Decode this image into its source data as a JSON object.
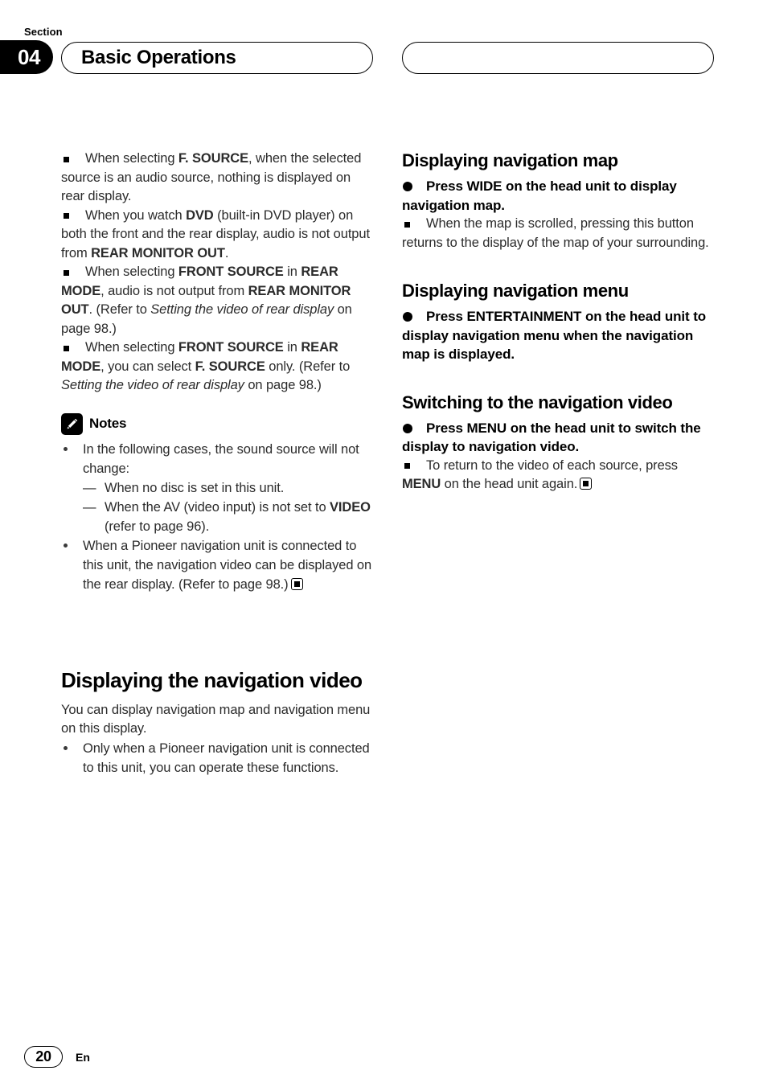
{
  "header": {
    "section_label": "Section",
    "section_number": "04",
    "title": "Basic Operations",
    "right_pill_text": ""
  },
  "left_column": {
    "notes_bullets": [
      {
        "id": "b1",
        "segments": [
          {
            "t": "When selecting ",
            "s": "normal"
          },
          {
            "t": "F. SOURCE",
            "s": "bold"
          },
          {
            "t": ", when the selected source is an audio source, nothing is displayed on rear display.",
            "s": "normal"
          }
        ]
      },
      {
        "id": "b2",
        "segments": [
          {
            "t": "When you watch ",
            "s": "normal"
          },
          {
            "t": "DVD",
            "s": "bold"
          },
          {
            "t": " (built-in DVD player) on both the front and the rear display, audio is not output from ",
            "s": "normal"
          },
          {
            "t": "REAR MONITOR OUT",
            "s": "bold"
          },
          {
            "t": ".",
            "s": "normal"
          }
        ]
      },
      {
        "id": "b3",
        "segments": [
          {
            "t": "When selecting ",
            "s": "normal"
          },
          {
            "t": "FRONT SOURCE",
            "s": "bold"
          },
          {
            "t": " in ",
            "s": "normal"
          },
          {
            "t": "REAR MODE",
            "s": "bold"
          },
          {
            "t": ", audio is not output from ",
            "s": "normal"
          },
          {
            "t": "REAR MONITOR OUT",
            "s": "bold"
          },
          {
            "t": ". (Refer to ",
            "s": "normal"
          },
          {
            "t": "Setting the video of rear display",
            "s": "italic"
          },
          {
            "t": " on page 98.)",
            "s": "normal"
          }
        ]
      },
      {
        "id": "b4",
        "segments": [
          {
            "t": "When selecting ",
            "s": "normal"
          },
          {
            "t": "FRONT SOURCE",
            "s": "bold"
          },
          {
            "t": " in ",
            "s": "normal"
          },
          {
            "t": "REAR MODE",
            "s": "bold"
          },
          {
            "t": ", you can select ",
            "s": "normal"
          },
          {
            "t": "F. SOURCE",
            "s": "bold"
          },
          {
            "t": " only. (Refer to ",
            "s": "normal"
          },
          {
            "t": "Setting the video of rear display",
            "s": "italic"
          },
          {
            "t": " on page 98.)",
            "s": "normal"
          }
        ]
      }
    ],
    "notes_block": {
      "icon": "pencil-icon",
      "label": "Notes",
      "item1_text": "In the following cases, the sound source will not change:",
      "sub_items": [
        {
          "dash": "—",
          "segments": [
            {
              "t": "When no disc is set in this unit.",
              "s": "normal"
            }
          ]
        },
        {
          "dash": "—",
          "segments": [
            {
              "t": "When the AV (video input) is not set to ",
              "s": "normal"
            },
            {
              "t": "VIDEO",
              "s": "bold"
            },
            {
              "t": " (refer to page 96).",
              "s": "normal"
            }
          ]
        }
      ],
      "item2_segments": [
        {
          "t": "When a Pioneer navigation unit is connected to this unit, the navigation video can be displayed on the rear display. (Refer to page 98.)",
          "s": "normal"
        },
        {
          "t": "",
          "s": "endmark"
        }
      ]
    },
    "main_heading": "Displaying the navigation video",
    "intro_text": "You can display navigation map and navigation menu on this display.",
    "intro_bullet": "Only when a Pioneer navigation unit is connected to this unit, you can operate these functions."
  },
  "right_column": {
    "sections": [
      {
        "heading": "Displaying navigation map",
        "action_segments": [
          {
            "t": "Press WIDE on the head unit to display navigation map.",
            "s": "bold"
          }
        ],
        "note_segments": [
          {
            "t": "When the map is scrolled, pressing this button returns to the display of the map of your surrounding.",
            "s": "normal"
          }
        ]
      },
      {
        "heading": "Displaying navigation menu",
        "action_segments": [
          {
            "t": "Press ENTERTAINMENT on the head unit to display navigation menu when the navigation map is displayed.",
            "s": "bold"
          }
        ],
        "note_segments": []
      },
      {
        "heading": "Switching to the navigation video",
        "action_segments": [
          {
            "t": "Press MENU on the head unit to switch the display to navigation video.",
            "s": "bold"
          }
        ],
        "note_segments": [
          {
            "t": "To return to the video of each source, press ",
            "s": "normal"
          },
          {
            "t": "MENU",
            "s": "bold"
          },
          {
            "t": " on the head unit again.",
            "s": "normal"
          },
          {
            "t": "",
            "s": "endmark"
          }
        ]
      }
    ]
  },
  "footer": {
    "page_number": "20",
    "language": "En"
  }
}
